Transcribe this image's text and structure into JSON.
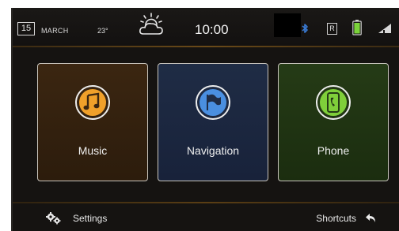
{
  "status": {
    "day": "15",
    "month": "MARCH",
    "temperature": "23°",
    "time": "10:00",
    "weather_icon": "partly-cloudy-icon",
    "radio_indicator": "R",
    "icons": [
      "bluetooth-icon",
      "battery-icon",
      "signal-icon"
    ]
  },
  "tiles": [
    {
      "label": "Music",
      "icon": "music-note-icon",
      "accent": "#f0a02a",
      "background": "#3b2611"
    },
    {
      "label": "Navigation",
      "icon": "flag-icon",
      "accent": "#4a8fe0",
      "background": "#1f2c45"
    },
    {
      "label": "Phone",
      "icon": "phone-icon",
      "accent": "#7fcf3a",
      "background": "#253b16"
    }
  ],
  "footer": {
    "settings_label": "Settings",
    "shortcuts_label": "Shortcuts"
  },
  "colors": {
    "divider_accent": "#6a4a18",
    "screen_background": "#151311",
    "battery": "#7bd23a",
    "bluetooth": "#3a7bd5"
  }
}
